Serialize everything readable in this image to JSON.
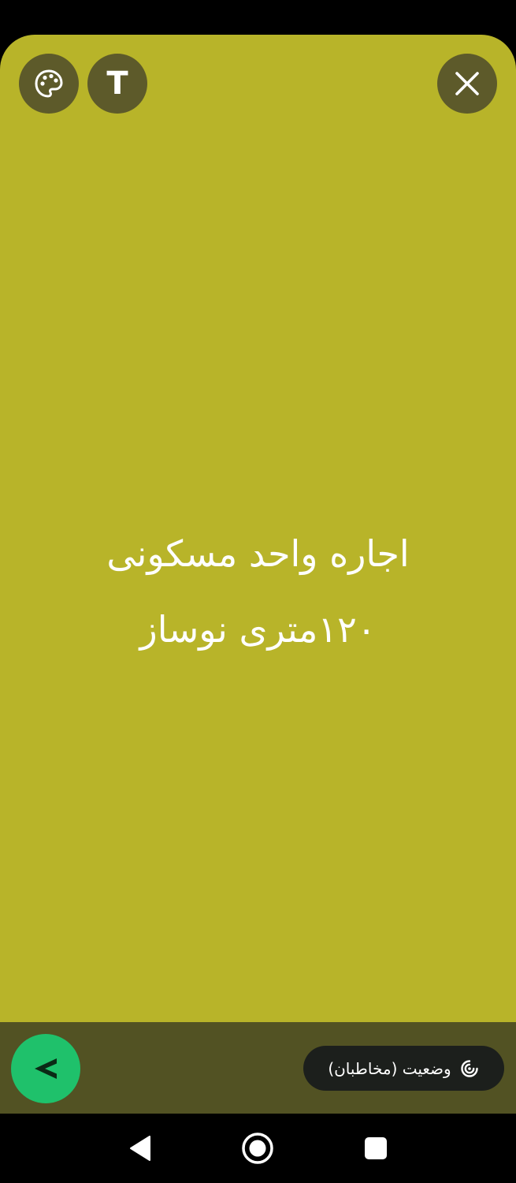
{
  "composer": {
    "background_color": "#b8b429",
    "status_text_lines": [
      "اجاره واحد مسکونی",
      "۱۲۰متری نوساز"
    ]
  },
  "toolbar": {
    "palette_icon": "palette-icon",
    "text_button_label": "T",
    "close_icon": "close-icon"
  },
  "footer": {
    "privacy_label": "وضعیت (مخاطبان)",
    "privacy_icon": "status-ring-icon",
    "send_icon": "send-arrow-icon",
    "send_color": "#1fc16b"
  },
  "navigation": {
    "back_icon": "back-triangle-icon",
    "home_icon": "home-circle-icon",
    "recents_icon": "recents-square-icon"
  }
}
